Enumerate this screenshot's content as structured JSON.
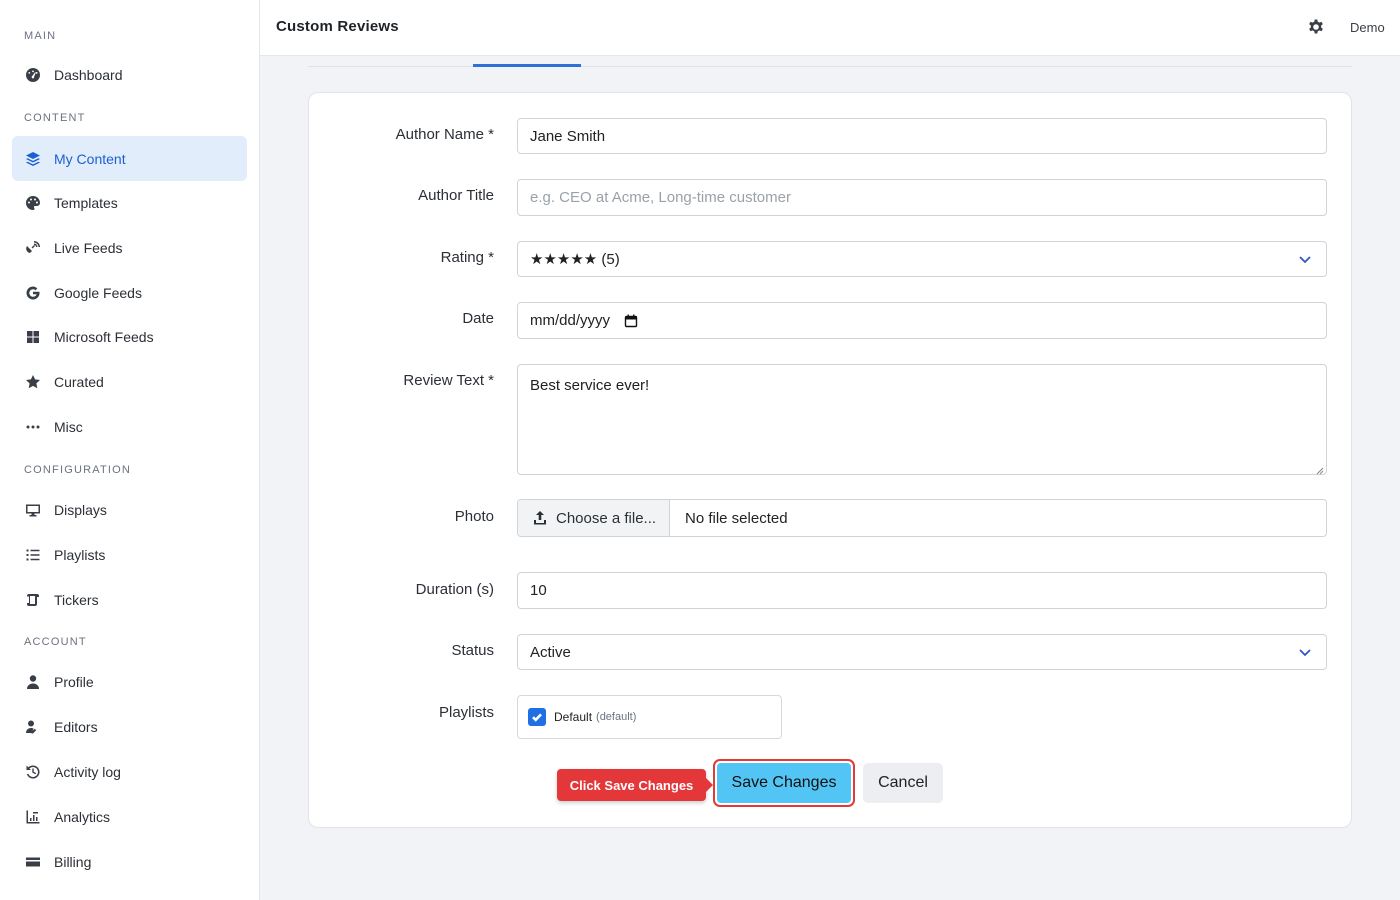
{
  "sidebar": {
    "sections": [
      {
        "label": "MAIN"
      },
      {
        "label": "CONTENT"
      },
      {
        "label": "CONFIGURATION"
      },
      {
        "label": "ACCOUNT"
      }
    ],
    "items": [
      {
        "label": "Dashboard",
        "icon": "dashboard-icon"
      },
      {
        "label": "My Content",
        "icon": "layers-icon",
        "active": true
      },
      {
        "label": "Templates",
        "icon": "palette-icon"
      },
      {
        "label": "Live Feeds",
        "icon": "satellite-dish-icon"
      },
      {
        "label": "Google Feeds",
        "icon": "google-icon"
      },
      {
        "label": "Microsoft Feeds",
        "icon": "windows-icon"
      },
      {
        "label": "Curated",
        "icon": "star-icon"
      },
      {
        "label": "Misc",
        "icon": "ellipsis-icon"
      },
      {
        "label": "Displays",
        "icon": "monitor-icon"
      },
      {
        "label": "Playlists",
        "icon": "list-icon"
      },
      {
        "label": "Tickers",
        "icon": "scroll-icon"
      },
      {
        "label": "Profile",
        "icon": "user-icon"
      },
      {
        "label": "Editors",
        "icon": "user-edit-icon"
      },
      {
        "label": "Activity log",
        "icon": "history-icon"
      },
      {
        "label": "Analytics",
        "icon": "chart-icon"
      },
      {
        "label": "Billing",
        "icon": "credit-card-icon"
      }
    ]
  },
  "header": {
    "title": "Custom Reviews",
    "user": "Demo",
    "settings_icon": "gear-icon"
  },
  "form": {
    "author_name": {
      "label": "Author Name *",
      "value": "Jane Smith"
    },
    "author_title": {
      "label": "Author Title",
      "placeholder": "e.g. CEO at Acme, Long-time customer"
    },
    "rating": {
      "label": "Rating *",
      "value": "★★★★★ (5)"
    },
    "date": {
      "label": "Date",
      "value": "mm/dd/yyyy"
    },
    "review_text": {
      "label": "Review Text *",
      "value": "Best service ever!"
    },
    "photo": {
      "label": "Photo",
      "button": "Choose a file...",
      "status": "No file selected"
    },
    "duration": {
      "label": "Duration (s)",
      "value": "10"
    },
    "status": {
      "label": "Status",
      "value": "Active"
    },
    "playlists": {
      "label": "Playlists",
      "items": [
        {
          "name": "Default",
          "tag": "(default)",
          "checked": true
        }
      ]
    }
  },
  "actions": {
    "save": "Save Changes",
    "cancel": "Cancel",
    "callout": "Click Save Changes"
  },
  "colors": {
    "accent": "#1d5fd0",
    "save_button": "#53c5f5",
    "highlight": "#e53935"
  }
}
